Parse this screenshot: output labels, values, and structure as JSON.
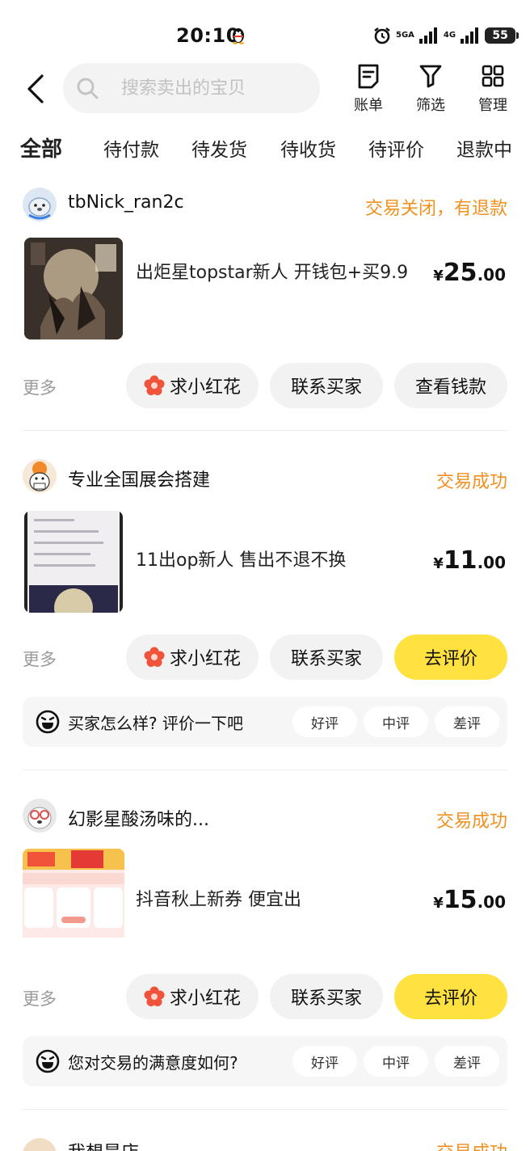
{
  "status_bar": {
    "time": "20:10",
    "network_1": "5GA",
    "network_2": "4G",
    "battery": "55"
  },
  "search": {
    "placeholder": "搜索卖出的宝贝"
  },
  "header_tools": [
    {
      "label": "账单",
      "icon": "bill-icon"
    },
    {
      "label": "筛选",
      "icon": "filter-icon"
    },
    {
      "label": "管理",
      "icon": "grid-icon"
    }
  ],
  "tabs": [
    "全部",
    "待付款",
    "待发货",
    "待收货",
    "待评价",
    "退款中"
  ],
  "colors": {
    "accent_yellow": "#ffe23f",
    "status_orange": "#f0901e",
    "flower_red": "#f0523a"
  },
  "orders": [
    {
      "seller": "tbNick_ran2c",
      "status": "交易关闭，有退款",
      "title": "出炬星topstar新人 开钱包+买9.9",
      "price_currency": "¥",
      "price_int": "25",
      "price_dec": ".00",
      "more": "更多",
      "buttons": [
        "求小红花",
        "联系买家",
        "查看钱款"
      ]
    },
    {
      "seller": "专业全国展会搭建",
      "status": "交易成功",
      "title": "11出op新人 售出不退不换",
      "price_currency": "¥",
      "price_int": "11",
      "price_dec": ".00",
      "more": "更多",
      "buttons": [
        "求小红花",
        "联系买家",
        "去评价"
      ],
      "rate_question": "买家怎么样? 评价一下吧",
      "rate_options": [
        "好评",
        "中评",
        "差评"
      ]
    },
    {
      "seller": "幻影星酸汤味的...",
      "status": "交易成功",
      "title": "抖音秋上新券 便宜出",
      "price_currency": "¥",
      "price_int": "15",
      "price_dec": ".00",
      "more": "更多",
      "buttons": [
        "求小红花",
        "联系买家",
        "去评价"
      ],
      "rate_question": "您对交易的满意度如何?",
      "rate_options": [
        "好评",
        "中评",
        "差评"
      ]
    },
    {
      "seller": "我想是店",
      "status": "交易成功"
    }
  ]
}
